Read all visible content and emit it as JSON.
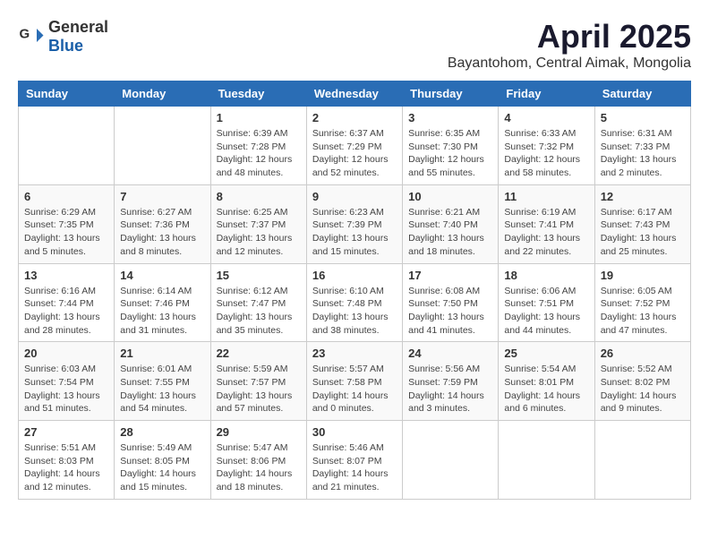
{
  "logo": {
    "general": "General",
    "blue": "Blue"
  },
  "header": {
    "month": "April 2025",
    "location": "Bayantohom, Central Aimak, Mongolia"
  },
  "weekdays": [
    "Sunday",
    "Monday",
    "Tuesday",
    "Wednesday",
    "Thursday",
    "Friday",
    "Saturday"
  ],
  "weeks": [
    [
      null,
      null,
      {
        "day": 1,
        "info": "Sunrise: 6:39 AM\nSunset: 7:28 PM\nDaylight: 12 hours and 48 minutes."
      },
      {
        "day": 2,
        "info": "Sunrise: 6:37 AM\nSunset: 7:29 PM\nDaylight: 12 hours and 52 minutes."
      },
      {
        "day": 3,
        "info": "Sunrise: 6:35 AM\nSunset: 7:30 PM\nDaylight: 12 hours and 55 minutes."
      },
      {
        "day": 4,
        "info": "Sunrise: 6:33 AM\nSunset: 7:32 PM\nDaylight: 12 hours and 58 minutes."
      },
      {
        "day": 5,
        "info": "Sunrise: 6:31 AM\nSunset: 7:33 PM\nDaylight: 13 hours and 2 minutes."
      }
    ],
    [
      {
        "day": 6,
        "info": "Sunrise: 6:29 AM\nSunset: 7:35 PM\nDaylight: 13 hours and 5 minutes."
      },
      {
        "day": 7,
        "info": "Sunrise: 6:27 AM\nSunset: 7:36 PM\nDaylight: 13 hours and 8 minutes."
      },
      {
        "day": 8,
        "info": "Sunrise: 6:25 AM\nSunset: 7:37 PM\nDaylight: 13 hours and 12 minutes."
      },
      {
        "day": 9,
        "info": "Sunrise: 6:23 AM\nSunset: 7:39 PM\nDaylight: 13 hours and 15 minutes."
      },
      {
        "day": 10,
        "info": "Sunrise: 6:21 AM\nSunset: 7:40 PM\nDaylight: 13 hours and 18 minutes."
      },
      {
        "day": 11,
        "info": "Sunrise: 6:19 AM\nSunset: 7:41 PM\nDaylight: 13 hours and 22 minutes."
      },
      {
        "day": 12,
        "info": "Sunrise: 6:17 AM\nSunset: 7:43 PM\nDaylight: 13 hours and 25 minutes."
      }
    ],
    [
      {
        "day": 13,
        "info": "Sunrise: 6:16 AM\nSunset: 7:44 PM\nDaylight: 13 hours and 28 minutes."
      },
      {
        "day": 14,
        "info": "Sunrise: 6:14 AM\nSunset: 7:46 PM\nDaylight: 13 hours and 31 minutes."
      },
      {
        "day": 15,
        "info": "Sunrise: 6:12 AM\nSunset: 7:47 PM\nDaylight: 13 hours and 35 minutes."
      },
      {
        "day": 16,
        "info": "Sunrise: 6:10 AM\nSunset: 7:48 PM\nDaylight: 13 hours and 38 minutes."
      },
      {
        "day": 17,
        "info": "Sunrise: 6:08 AM\nSunset: 7:50 PM\nDaylight: 13 hours and 41 minutes."
      },
      {
        "day": 18,
        "info": "Sunrise: 6:06 AM\nSunset: 7:51 PM\nDaylight: 13 hours and 44 minutes."
      },
      {
        "day": 19,
        "info": "Sunrise: 6:05 AM\nSunset: 7:52 PM\nDaylight: 13 hours and 47 minutes."
      }
    ],
    [
      {
        "day": 20,
        "info": "Sunrise: 6:03 AM\nSunset: 7:54 PM\nDaylight: 13 hours and 51 minutes."
      },
      {
        "day": 21,
        "info": "Sunrise: 6:01 AM\nSunset: 7:55 PM\nDaylight: 13 hours and 54 minutes."
      },
      {
        "day": 22,
        "info": "Sunrise: 5:59 AM\nSunset: 7:57 PM\nDaylight: 13 hours and 57 minutes."
      },
      {
        "day": 23,
        "info": "Sunrise: 5:57 AM\nSunset: 7:58 PM\nDaylight: 14 hours and 0 minutes."
      },
      {
        "day": 24,
        "info": "Sunrise: 5:56 AM\nSunset: 7:59 PM\nDaylight: 14 hours and 3 minutes."
      },
      {
        "day": 25,
        "info": "Sunrise: 5:54 AM\nSunset: 8:01 PM\nDaylight: 14 hours and 6 minutes."
      },
      {
        "day": 26,
        "info": "Sunrise: 5:52 AM\nSunset: 8:02 PM\nDaylight: 14 hours and 9 minutes."
      }
    ],
    [
      {
        "day": 27,
        "info": "Sunrise: 5:51 AM\nSunset: 8:03 PM\nDaylight: 14 hours and 12 minutes."
      },
      {
        "day": 28,
        "info": "Sunrise: 5:49 AM\nSunset: 8:05 PM\nDaylight: 14 hours and 15 minutes."
      },
      {
        "day": 29,
        "info": "Sunrise: 5:47 AM\nSunset: 8:06 PM\nDaylight: 14 hours and 18 minutes."
      },
      {
        "day": 30,
        "info": "Sunrise: 5:46 AM\nSunset: 8:07 PM\nDaylight: 14 hours and 21 minutes."
      },
      null,
      null,
      null
    ]
  ]
}
